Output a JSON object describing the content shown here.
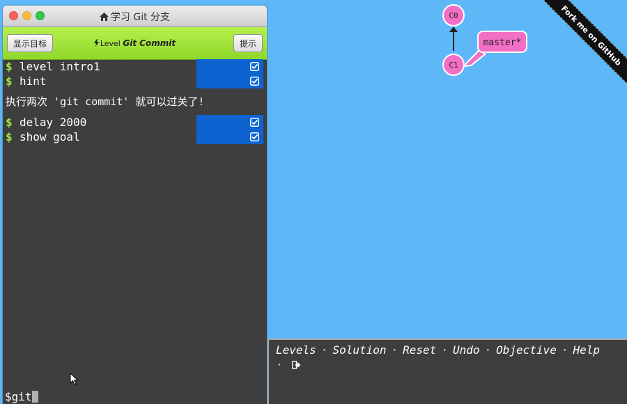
{
  "window": {
    "title": "学习 Git 分支"
  },
  "toolbar": {
    "show_goal_label": "显示目标",
    "hint_label": "提示",
    "level_prefix": "Level",
    "level_name": "Git Commit"
  },
  "terminal": {
    "commands": [
      {
        "prompt": "$",
        "text": "level intro1",
        "checked": true
      },
      {
        "prompt": "$",
        "text": "hint",
        "checked": true
      },
      {
        "prompt": "$",
        "text": "delay 2000",
        "checked": true
      },
      {
        "prompt": "$",
        "text": "show goal",
        "checked": true
      }
    ],
    "message": "执行两次 'git commit' 就可以过关了!",
    "input_prompt": "$",
    "input_value": "git"
  },
  "graph": {
    "commits": [
      "C0",
      "C1"
    ],
    "branch_label": "master*",
    "commit_color": "#f26fc6",
    "branch_color": "#f26fc6"
  },
  "ribbon": {
    "text": "Fork me on GitHub"
  },
  "commands_bar": {
    "levels": "Levels",
    "solution": "Solution",
    "reset": "Reset",
    "undo": "Undo",
    "objective": "Objective",
    "help": "Help",
    "separator": "·"
  },
  "colors": {
    "background": "#5eb8f8",
    "toolbar_green": "#9ee234",
    "terminal_bg": "#3e3e3e",
    "status_blue": "#0d64d0",
    "prompt_green": "#a1e840"
  }
}
